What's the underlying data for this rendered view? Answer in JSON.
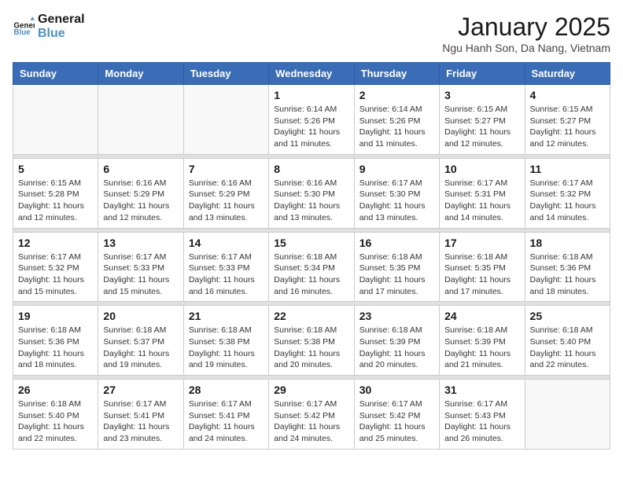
{
  "logo": {
    "line1": "General",
    "line2": "Blue"
  },
  "header": {
    "month": "January 2025",
    "location": "Ngu Hanh Son, Da Nang, Vietnam"
  },
  "days_of_week": [
    "Sunday",
    "Monday",
    "Tuesday",
    "Wednesday",
    "Thursday",
    "Friday",
    "Saturday"
  ],
  "weeks": [
    [
      {
        "day": "",
        "info": ""
      },
      {
        "day": "",
        "info": ""
      },
      {
        "day": "",
        "info": ""
      },
      {
        "day": "1",
        "info": "Sunrise: 6:14 AM\nSunset: 5:26 PM\nDaylight: 11 hours and 11 minutes."
      },
      {
        "day": "2",
        "info": "Sunrise: 6:14 AM\nSunset: 5:26 PM\nDaylight: 11 hours and 11 minutes."
      },
      {
        "day": "3",
        "info": "Sunrise: 6:15 AM\nSunset: 5:27 PM\nDaylight: 11 hours and 12 minutes."
      },
      {
        "day": "4",
        "info": "Sunrise: 6:15 AM\nSunset: 5:27 PM\nDaylight: 11 hours and 12 minutes."
      }
    ],
    [
      {
        "day": "5",
        "info": "Sunrise: 6:15 AM\nSunset: 5:28 PM\nDaylight: 11 hours and 12 minutes."
      },
      {
        "day": "6",
        "info": "Sunrise: 6:16 AM\nSunset: 5:29 PM\nDaylight: 11 hours and 12 minutes."
      },
      {
        "day": "7",
        "info": "Sunrise: 6:16 AM\nSunset: 5:29 PM\nDaylight: 11 hours and 13 minutes."
      },
      {
        "day": "8",
        "info": "Sunrise: 6:16 AM\nSunset: 5:30 PM\nDaylight: 11 hours and 13 minutes."
      },
      {
        "day": "9",
        "info": "Sunrise: 6:17 AM\nSunset: 5:30 PM\nDaylight: 11 hours and 13 minutes."
      },
      {
        "day": "10",
        "info": "Sunrise: 6:17 AM\nSunset: 5:31 PM\nDaylight: 11 hours and 14 minutes."
      },
      {
        "day": "11",
        "info": "Sunrise: 6:17 AM\nSunset: 5:32 PM\nDaylight: 11 hours and 14 minutes."
      }
    ],
    [
      {
        "day": "12",
        "info": "Sunrise: 6:17 AM\nSunset: 5:32 PM\nDaylight: 11 hours and 15 minutes."
      },
      {
        "day": "13",
        "info": "Sunrise: 6:17 AM\nSunset: 5:33 PM\nDaylight: 11 hours and 15 minutes."
      },
      {
        "day": "14",
        "info": "Sunrise: 6:17 AM\nSunset: 5:33 PM\nDaylight: 11 hours and 16 minutes."
      },
      {
        "day": "15",
        "info": "Sunrise: 6:18 AM\nSunset: 5:34 PM\nDaylight: 11 hours and 16 minutes."
      },
      {
        "day": "16",
        "info": "Sunrise: 6:18 AM\nSunset: 5:35 PM\nDaylight: 11 hours and 17 minutes."
      },
      {
        "day": "17",
        "info": "Sunrise: 6:18 AM\nSunset: 5:35 PM\nDaylight: 11 hours and 17 minutes."
      },
      {
        "day": "18",
        "info": "Sunrise: 6:18 AM\nSunset: 5:36 PM\nDaylight: 11 hours and 18 minutes."
      }
    ],
    [
      {
        "day": "19",
        "info": "Sunrise: 6:18 AM\nSunset: 5:36 PM\nDaylight: 11 hours and 18 minutes."
      },
      {
        "day": "20",
        "info": "Sunrise: 6:18 AM\nSunset: 5:37 PM\nDaylight: 11 hours and 19 minutes."
      },
      {
        "day": "21",
        "info": "Sunrise: 6:18 AM\nSunset: 5:38 PM\nDaylight: 11 hours and 19 minutes."
      },
      {
        "day": "22",
        "info": "Sunrise: 6:18 AM\nSunset: 5:38 PM\nDaylight: 11 hours and 20 minutes."
      },
      {
        "day": "23",
        "info": "Sunrise: 6:18 AM\nSunset: 5:39 PM\nDaylight: 11 hours and 20 minutes."
      },
      {
        "day": "24",
        "info": "Sunrise: 6:18 AM\nSunset: 5:39 PM\nDaylight: 11 hours and 21 minutes."
      },
      {
        "day": "25",
        "info": "Sunrise: 6:18 AM\nSunset: 5:40 PM\nDaylight: 11 hours and 22 minutes."
      }
    ],
    [
      {
        "day": "26",
        "info": "Sunrise: 6:18 AM\nSunset: 5:40 PM\nDaylight: 11 hours and 22 minutes."
      },
      {
        "day": "27",
        "info": "Sunrise: 6:17 AM\nSunset: 5:41 PM\nDaylight: 11 hours and 23 minutes."
      },
      {
        "day": "28",
        "info": "Sunrise: 6:17 AM\nSunset: 5:41 PM\nDaylight: 11 hours and 24 minutes."
      },
      {
        "day": "29",
        "info": "Sunrise: 6:17 AM\nSunset: 5:42 PM\nDaylight: 11 hours and 24 minutes."
      },
      {
        "day": "30",
        "info": "Sunrise: 6:17 AM\nSunset: 5:42 PM\nDaylight: 11 hours and 25 minutes."
      },
      {
        "day": "31",
        "info": "Sunrise: 6:17 AM\nSunset: 5:43 PM\nDaylight: 11 hours and 26 minutes."
      },
      {
        "day": "",
        "info": ""
      }
    ]
  ]
}
